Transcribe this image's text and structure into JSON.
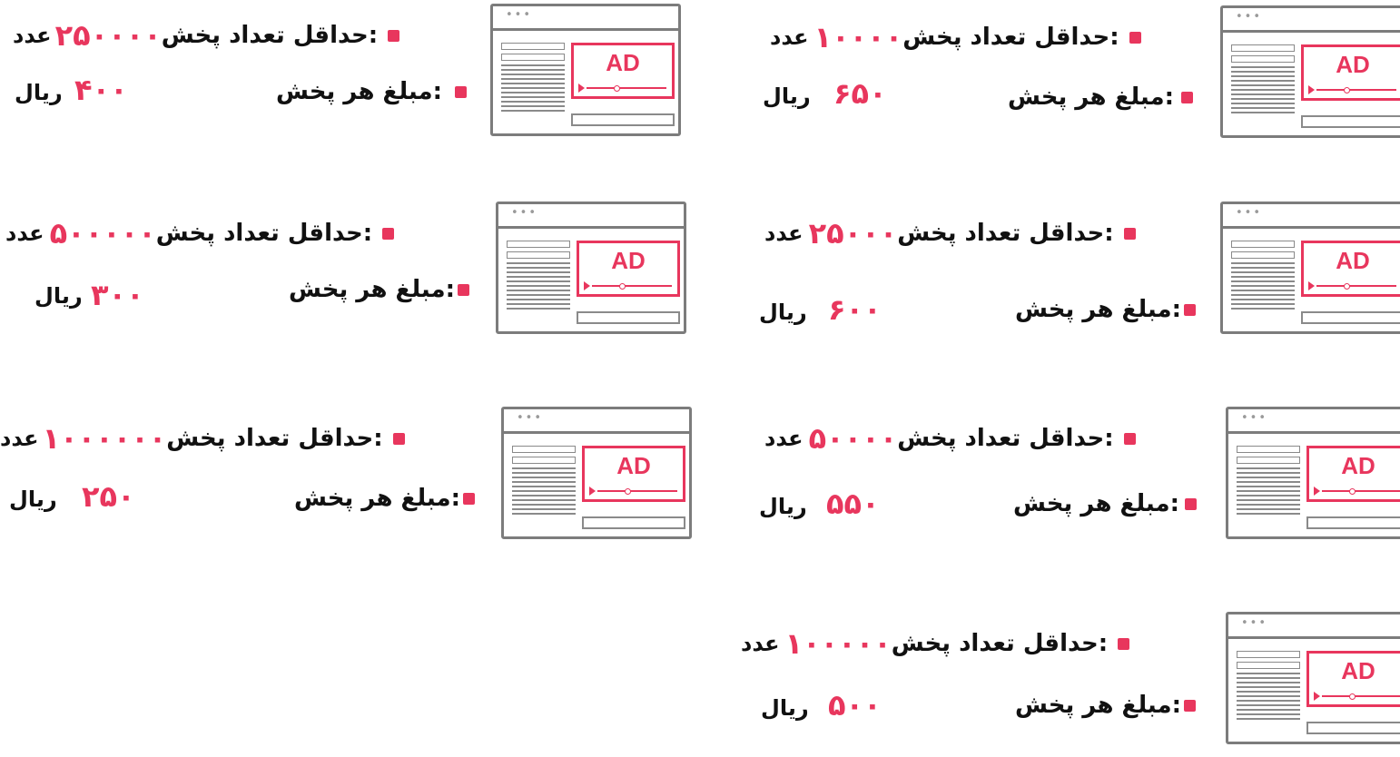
{
  "labels": {
    "count_label": "حداقل تعداد پخش:",
    "price_label": "مبلغ هر پخش:",
    "count_unit": "عدد",
    "price_unit": "ریال",
    "ad_text": "AD",
    "dots": "•••"
  },
  "colors": {
    "accent": "#e8365d",
    "frame": "#7c7c7c",
    "text": "#111111"
  },
  "plans": [
    {
      "min_count": "۱۰۰۰۰",
      "price": "۶۵۰"
    },
    {
      "min_count": "۲۵۰۰۰۰",
      "price": "۴۰۰"
    },
    {
      "min_count": "۲۵۰۰۰",
      "price": "۶۰۰"
    },
    {
      "min_count": "۵۰۰۰۰۰",
      "price": "۳۰۰"
    },
    {
      "min_count": "۵۰۰۰۰",
      "price": "۵۵۰"
    },
    {
      "min_count": "۱۰۰۰۰۰۰",
      "price": "۲۵۰"
    },
    {
      "min_count": "۱۰۰۰۰۰",
      "price": "۵۰۰"
    }
  ]
}
